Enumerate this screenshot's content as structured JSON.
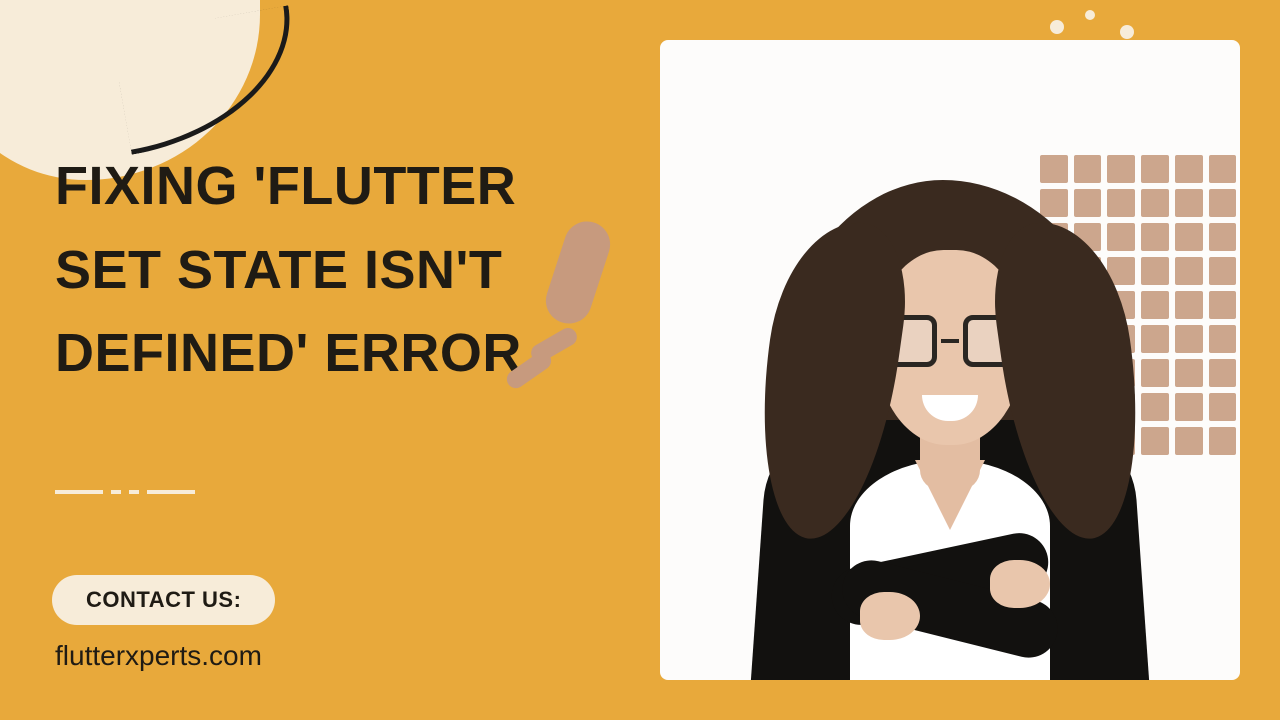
{
  "headline": "FIXING 'FLUTTER SET STATE ISN'T DEFINED' ERROR",
  "cta_label": "CONTACT US:",
  "url": "flutterxperts.com",
  "colors": {
    "background": "#e8a93b",
    "cream": "#f7ecd9",
    "dark": "#1f1b14",
    "tan": "#c79a7e"
  }
}
